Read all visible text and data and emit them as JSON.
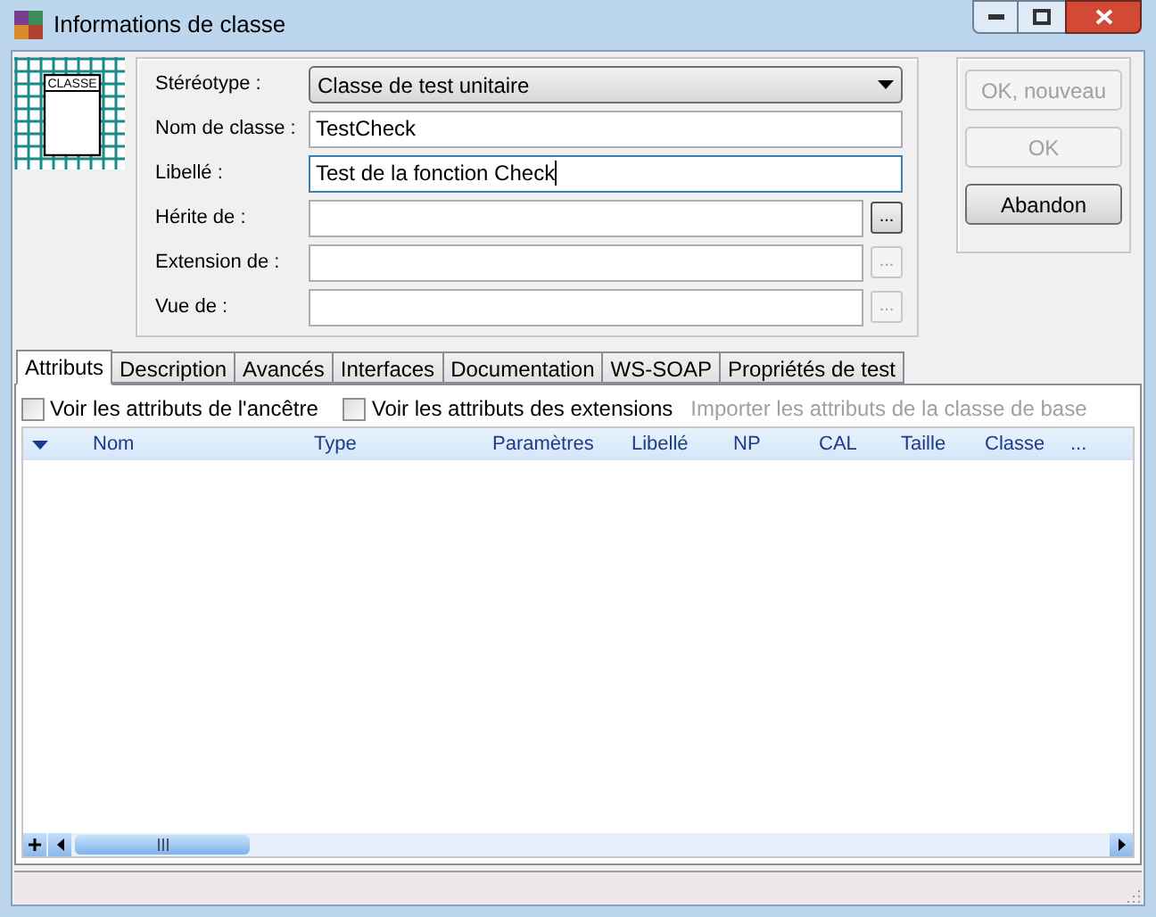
{
  "window": {
    "title": "Informations de classe"
  },
  "class_icon": {
    "label": "CLASSE"
  },
  "form": {
    "stereotype": {
      "label": "Stéréotype :",
      "value": "Classe de test unitaire"
    },
    "fields": [
      {
        "label": "Nom de classe :",
        "value": "TestCheck",
        "focused": false
      },
      {
        "label": "Libellé :",
        "value": "Test de la fonction Check",
        "focused": true
      },
      {
        "label": "Hérite de :",
        "browse": "...",
        "browse_disabled": false
      },
      {
        "label": "Extension de :",
        "browse": "...",
        "browse_disabled": true
      },
      {
        "label": "Vue de :",
        "browse": "...",
        "browse_disabled": true
      }
    ]
  },
  "buttons": [
    {
      "label": "OK, nouveau",
      "disabled": true
    },
    {
      "label": "OK",
      "disabled": true
    },
    {
      "label": "Abandon",
      "disabled": false
    }
  ],
  "tabs": [
    {
      "label": "Attributs",
      "selected": true
    },
    {
      "label": "Description",
      "selected": false
    },
    {
      "label": "Avancés",
      "selected": false
    },
    {
      "label": "Interfaces",
      "selected": false
    },
    {
      "label": "Documentation",
      "selected": false
    },
    {
      "label": "WS-SOAP",
      "selected": false
    },
    {
      "label": "Propriétés de test",
      "selected": false
    }
  ],
  "options": [
    {
      "label": "Voir les attributs de l'ancêtre",
      "checked": false
    },
    {
      "label": "Voir les attributs des extensions",
      "checked": false
    }
  ],
  "import_link": {
    "label": "Importer les attributs de la classe de base",
    "disabled": true
  },
  "table": {
    "columns": [
      "Nom",
      "Type",
      "Paramètres",
      "Libellé",
      "NP",
      "CAL",
      "Taille",
      "Classe",
      "..."
    ]
  }
}
